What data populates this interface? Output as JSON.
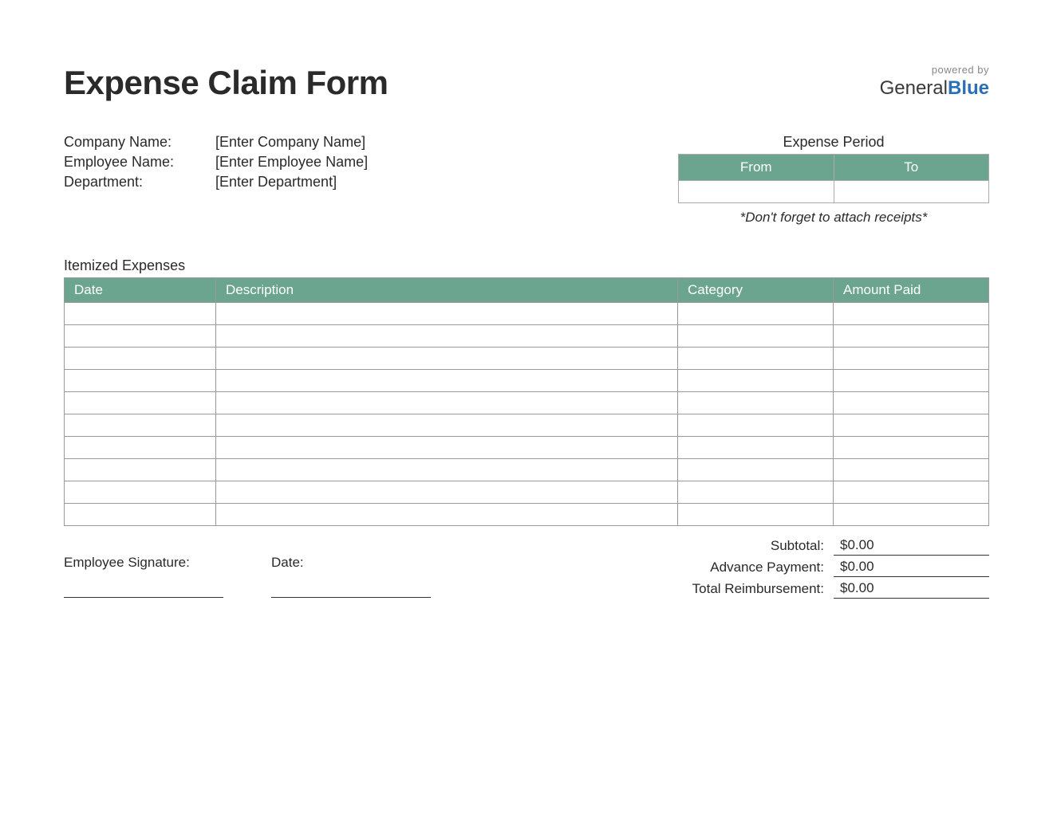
{
  "title": "Expense Claim Form",
  "logo": {
    "powered_by": "powered by",
    "brand1": "General",
    "brand2": "Blue"
  },
  "info": {
    "company_label": "Company Name:",
    "company_value": "[Enter Company Name]",
    "employee_label": "Employee Name:",
    "employee_value": "[Enter Employee Name]",
    "department_label": "Department:",
    "department_value": "[Enter Department]"
  },
  "period": {
    "title": "Expense Period",
    "from": "From",
    "to": "To",
    "from_value": "",
    "to_value": ""
  },
  "note": "*Don't forget to attach receipts*",
  "itemized_label": "Itemized Expenses",
  "columns": {
    "date": "Date",
    "description": "Description",
    "category": "Category",
    "amount": "Amount Paid"
  },
  "rows": [
    {
      "date": "",
      "description": "",
      "category": "",
      "amount": ""
    },
    {
      "date": "",
      "description": "",
      "category": "",
      "amount": ""
    },
    {
      "date": "",
      "description": "",
      "category": "",
      "amount": ""
    },
    {
      "date": "",
      "description": "",
      "category": "",
      "amount": ""
    },
    {
      "date": "",
      "description": "",
      "category": "",
      "amount": ""
    },
    {
      "date": "",
      "description": "",
      "category": "",
      "amount": ""
    },
    {
      "date": "",
      "description": "",
      "category": "",
      "amount": ""
    },
    {
      "date": "",
      "description": "",
      "category": "",
      "amount": ""
    },
    {
      "date": "",
      "description": "",
      "category": "",
      "amount": ""
    },
    {
      "date": "",
      "description": "",
      "category": "",
      "amount": ""
    }
  ],
  "signature": {
    "employee_label": "Employee Signature:",
    "date_label": "Date:"
  },
  "totals": {
    "subtotal_label": "Subtotal:",
    "subtotal_value": "$0.00",
    "advance_label": "Advance Payment:",
    "advance_value": "$0.00",
    "reimbursement_label": "Total Reimbursement:",
    "reimbursement_value": "$0.00"
  }
}
